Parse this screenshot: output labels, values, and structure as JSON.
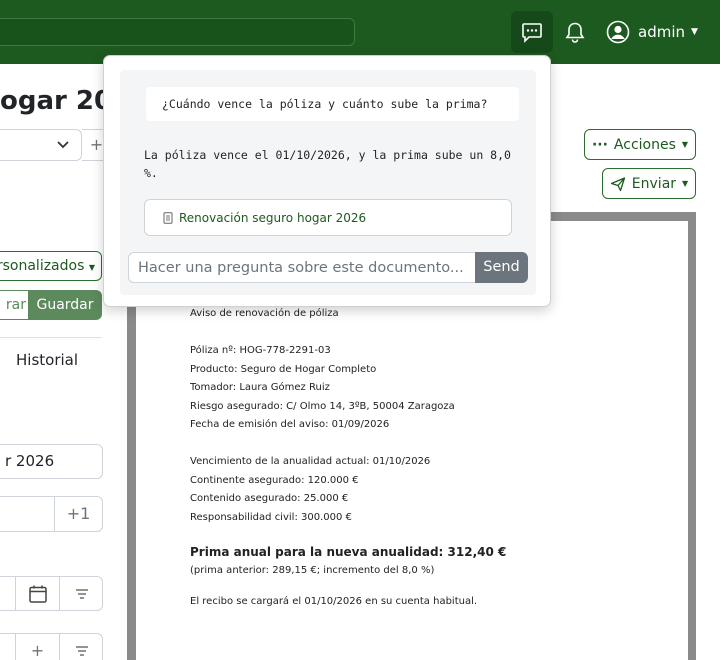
{
  "header": {
    "user_name": "admin"
  },
  "left_panel": {
    "title_fragment": "ogar 202",
    "select_plus": "+",
    "personalizados_label": "rsonalizados",
    "cancel_fragment": "rar",
    "save_label": "Guardar",
    "history_tab": "Historial",
    "year_field_value": "r 2026",
    "number_stepper_label": "+1",
    "last_row_plus": "+"
  },
  "toolbar": {
    "actions_label": "Acciones",
    "send_menu_label": "Enviar"
  },
  "chat": {
    "question": "¿Cuándo vence la póliza y cuánto sube la prima?",
    "answer": "La póliza vence el 01/10/2026, y la prima sube un 8,0 %.",
    "source_doc": "Renovación seguro hogar 2026",
    "input_placeholder": "Hacer una pregunta sobre este documento...",
    "send_label": "Send"
  },
  "document": {
    "heading": "Aviso de renovación de póliza",
    "policy_no": "Póliza nº: HOG-778-2291-03",
    "product": "Producto: Seguro de Hogar Completo",
    "holder": "Tomador: Laura Gómez Ruiz",
    "insured_risk": "Riesgo asegurado: C/ Olmo 14, 3ºB, 50004 Zaragoza",
    "issue_date": "Fecha de emisión del aviso: 01/09/2026",
    "expiry": "Vencimiento de la anualidad actual: 01/10/2026",
    "building": "Continente asegurado: 120.000 €",
    "contents": "Contenido asegurado: 25.000 €",
    "liability": "Responsabilidad civil: 300.000 €",
    "premium": "Prima anual para la nueva anualidad: 312,40 €",
    "premium_note": "(prima anterior: 289,15 €; incremento del 8,0 %)",
    "charge_note": "El recibo se cargará el 01/10/2026 en su cuenta habitual."
  },
  "colors": {
    "brand": "#1d5a1f",
    "send_button": "#6c757d"
  }
}
